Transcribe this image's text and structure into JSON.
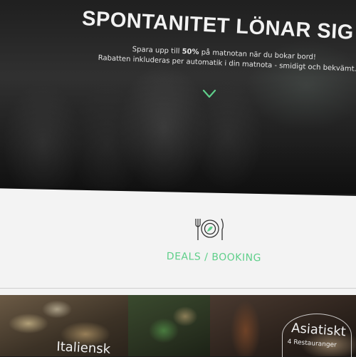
{
  "hero": {
    "title": "SPONTANITET LÖNAR SIG",
    "line1_prefix": "Spara upp till ",
    "line1_bold": "50%",
    "line1_suffix": " på matnotan när du bokar bord!",
    "line2": "Rabatten inkluderas per automatik i din matnota - smidigt och bekvämt.",
    "scroll_icon": "chevron-down-icon"
  },
  "section": {
    "icon": "plate-cutlery-icon",
    "heading": "DEALS / BOOKING",
    "accent_color": "#5fcf8a"
  },
  "categories": [
    {
      "label": "Italiensk",
      "sublabel": ""
    },
    {
      "label": "",
      "sublabel": ""
    },
    {
      "label": "Asiatiskt",
      "sublabel": "4 Restauranger"
    }
  ]
}
